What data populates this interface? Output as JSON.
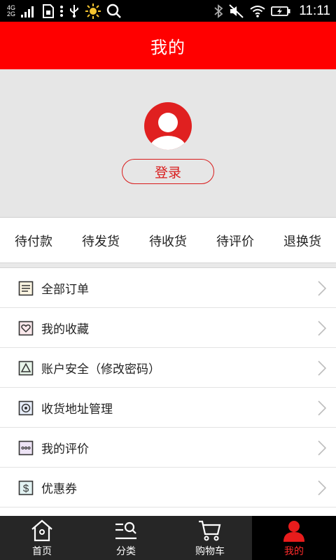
{
  "status_bar": {
    "network_top": "4G",
    "network_bottom": "2G",
    "time": "11:11",
    "icons": [
      "signal-icon",
      "sim-icon",
      "menu-dots-icon",
      "usb-icon",
      "brightness-icon",
      "search-icon",
      "bluetooth-icon",
      "mute-icon",
      "wifi-icon",
      "battery-icon"
    ]
  },
  "header": {
    "title": "我的"
  },
  "profile": {
    "login_label": "登录",
    "avatar_icon": "user-avatar-icon"
  },
  "order_tabs": [
    {
      "label": "待付款"
    },
    {
      "label": "待发货"
    },
    {
      "label": "待收货"
    },
    {
      "label": "待评价"
    },
    {
      "label": "退换货"
    }
  ],
  "menu": [
    {
      "label": "全部订单",
      "icon": "orders-icon"
    },
    {
      "label": "我的收藏",
      "icon": "favorites-icon"
    },
    {
      "label": "账户安全（修改密码）",
      "icon": "security-icon"
    },
    {
      "label": "收货地址管理",
      "icon": "address-icon"
    },
    {
      "label": "我的评价",
      "icon": "reviews-icon"
    },
    {
      "label": "优惠券",
      "icon": "coupon-icon"
    }
  ],
  "bottom_nav": [
    {
      "label": "首页",
      "icon": "home-icon",
      "active": false
    },
    {
      "label": "分类",
      "icon": "category-icon",
      "active": false
    },
    {
      "label": "购物车",
      "icon": "cart-icon",
      "active": false
    },
    {
      "label": "我的",
      "icon": "profile-icon",
      "active": true
    }
  ],
  "colors": {
    "brand_red": "#ff0000",
    "accent_red": "#d91a1a",
    "nav_bg": "#262626"
  }
}
